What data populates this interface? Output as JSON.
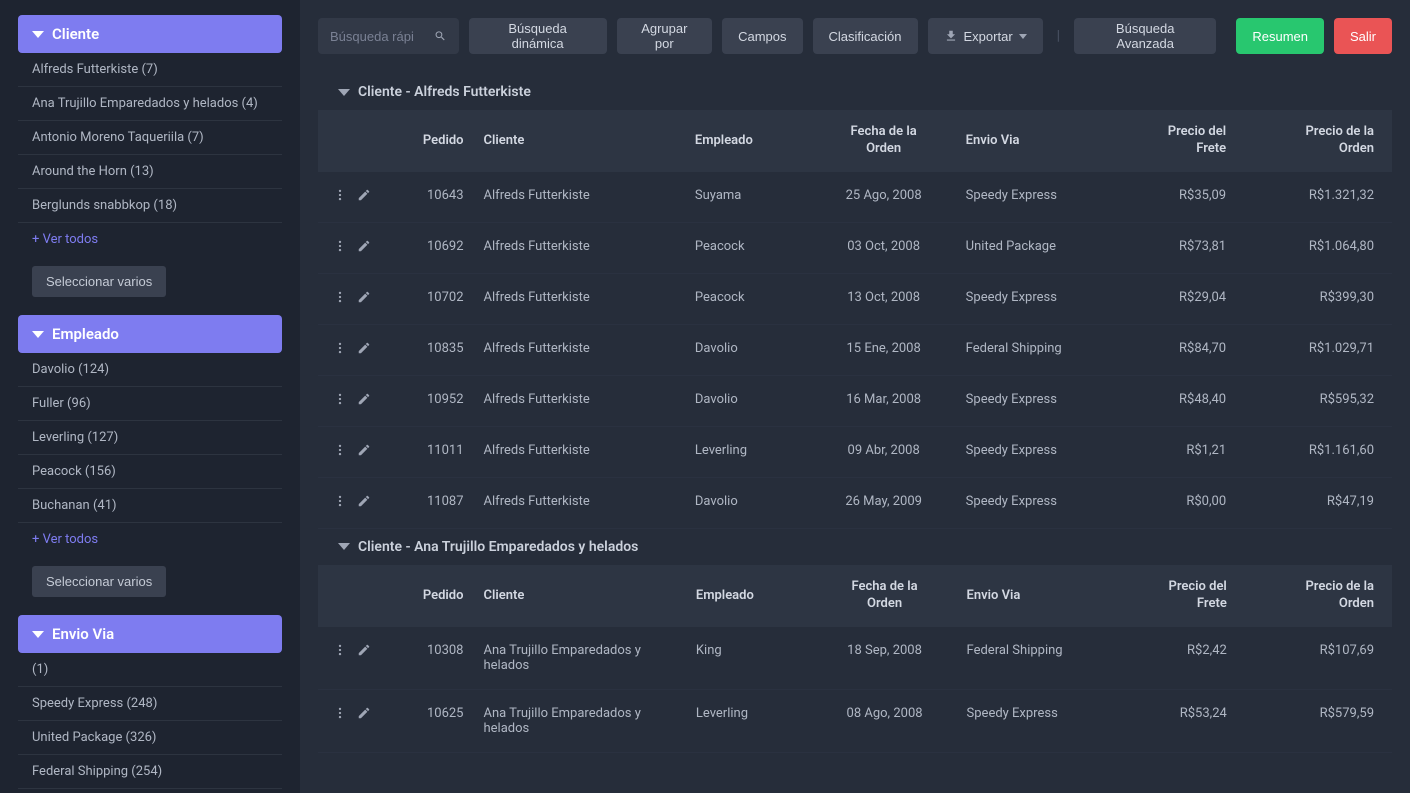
{
  "sidebar": {
    "panels": [
      {
        "title": "Cliente",
        "items": [
          "Alfreds Futterkiste (7)",
          "Ana Trujillo Emparedados y helados (4)",
          "Antonio Moreno Taqueriila (7)",
          "Around the Horn (13)",
          "Berglunds snabbkop (18)"
        ],
        "ver_todos": "+ Ver todos",
        "select": "Seleccionar varios"
      },
      {
        "title": "Empleado",
        "items": [
          "Davolio (124)",
          "Fuller (96)",
          "Leverling (127)",
          "Peacock (156)",
          "Buchanan (41)"
        ],
        "ver_todos": "+ Ver todos",
        "select": "Seleccionar varios"
      },
      {
        "title": "Envio Via",
        "items": [
          " (1)",
          "Speedy Express (248)",
          "United Package (326)",
          "Federal Shipping (254)"
        ],
        "ver_todos": "",
        "select": ""
      }
    ]
  },
  "toolbar": {
    "search_placeholder": "Búsqueda rápi",
    "busqueda_dinamica": "Búsqueda dinámica",
    "agrupar": "Agrupar por",
    "campos": "Campos",
    "clasificacion": "Clasificación",
    "exportar": "Exportar",
    "busqueda_avanzada": "Búsqueda Avanzada",
    "resumen": "Resumen",
    "salir": "Salir"
  },
  "columns": {
    "pedido": "Pedido",
    "cliente": "Cliente",
    "empleado": "Empleado",
    "fecha": "Fecha de la Orden",
    "envio": "Envio Via",
    "frete": "Precio del Frete",
    "orden": "Precio de la Orden"
  },
  "groups": [
    {
      "title": "Cliente - Alfreds Futterkiste",
      "rows": [
        {
          "pedido": "10643",
          "cliente": "Alfreds Futterkiste",
          "empleado": "Suyama",
          "fecha": "25 Ago, 2008",
          "envio": "Speedy Express",
          "frete": "R$35,09",
          "orden": "R$1.321,32"
        },
        {
          "pedido": "10692",
          "cliente": "Alfreds Futterkiste",
          "empleado": "Peacock",
          "fecha": "03 Oct, 2008",
          "envio": "United Package",
          "frete": "R$73,81",
          "orden": "R$1.064,80"
        },
        {
          "pedido": "10702",
          "cliente": "Alfreds Futterkiste",
          "empleado": "Peacock",
          "fecha": "13 Oct, 2008",
          "envio": "Speedy Express",
          "frete": "R$29,04",
          "orden": "R$399,30"
        },
        {
          "pedido": "10835",
          "cliente": "Alfreds Futterkiste",
          "empleado": "Davolio",
          "fecha": "15 Ene, 2008",
          "envio": "Federal Shipping",
          "frete": "R$84,70",
          "orden": "R$1.029,71"
        },
        {
          "pedido": "10952",
          "cliente": "Alfreds Futterkiste",
          "empleado": "Davolio",
          "fecha": "16 Mar, 2008",
          "envio": "Speedy Express",
          "frete": "R$48,40",
          "orden": "R$595,32"
        },
        {
          "pedido": "11011",
          "cliente": "Alfreds Futterkiste",
          "empleado": "Leverling",
          "fecha": "09 Abr, 2008",
          "envio": "Speedy Express",
          "frete": "R$1,21",
          "orden": "R$1.161,60"
        },
        {
          "pedido": "11087",
          "cliente": "Alfreds Futterkiste",
          "empleado": "Davolio",
          "fecha": "26 May, 2009",
          "envio": "Speedy Express",
          "frete": "R$0,00",
          "orden": "R$47,19"
        }
      ]
    },
    {
      "title": "Cliente - Ana Trujillo Emparedados y helados",
      "rows": [
        {
          "pedido": "10308",
          "cliente": "Ana Trujillo Emparedados y helados",
          "empleado": "King",
          "fecha": "18 Sep, 2008",
          "envio": "Federal Shipping",
          "frete": "R$2,42",
          "orden": "R$107,69"
        },
        {
          "pedido": "10625",
          "cliente": "Ana Trujillo Emparedados y helados",
          "empleado": "Leverling",
          "fecha": "08 Ago, 2008",
          "envio": "Speedy Express",
          "frete": "R$53,24",
          "orden": "R$579,59"
        }
      ]
    }
  ]
}
